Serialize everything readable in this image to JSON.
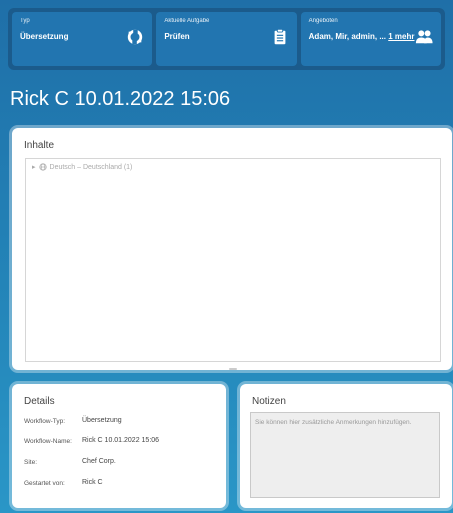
{
  "header": {
    "type": {
      "caption": "Typ",
      "value": "Übersetzung",
      "icon": "refresh-icon"
    },
    "task": {
      "caption": "Aktuelle Aufgabe",
      "value": "Prüfen",
      "icon": "clipboard-icon"
    },
    "offered": {
      "caption": "Angeboten",
      "value": "Adam, Mir, admin, ...",
      "more": "1 mehr",
      "icon": "users-icon"
    }
  },
  "page_title": "Rick C 10.01.2022 15:06",
  "content": {
    "title": "Inhalte",
    "tree_item": "Deutsch – Deutschland (1)"
  },
  "details": {
    "title": "Details",
    "rows": [
      {
        "label": "Workflow-Typ:",
        "value": "Übersetzung"
      },
      {
        "label": "Workflow-Name:",
        "value": "Rick C 10.01.2022 15:06"
      },
      {
        "label": "Site:",
        "value": "Chef Corp."
      },
      {
        "label": "Gestartet von:",
        "value": "Rick C"
      }
    ]
  },
  "notes": {
    "title": "Notizen",
    "placeholder": "Sie können hier zusätzliche Anmerkungen hinzufügen."
  },
  "colors": {
    "header_bg": "#1b5b8c",
    "tile_bg": "#2275b0",
    "page_bg": "#2384b8"
  }
}
